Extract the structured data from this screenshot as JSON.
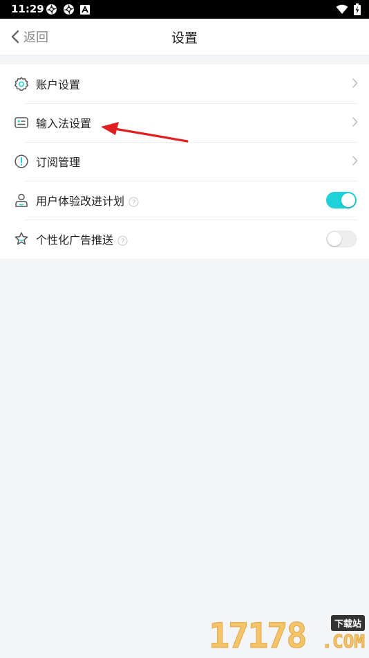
{
  "status_bar": {
    "time": "11:29",
    "icons": [
      "aperture-icon",
      "aperture-icon",
      "a-box-icon",
      "wifi-icon",
      "battery-charging-icon"
    ]
  },
  "header": {
    "back_label": "返回",
    "title": "设置"
  },
  "menu": {
    "items": [
      {
        "label": "账户设置",
        "icon": "gear-icon",
        "control": "chevron"
      },
      {
        "label": "输入法设置",
        "icon": "keyboard-icon",
        "control": "chevron"
      },
      {
        "label": "订阅管理",
        "icon": "exclamation-circle-icon",
        "control": "chevron"
      },
      {
        "label": "用户体验改进计划",
        "icon": "user-icon",
        "control": "toggle",
        "help": "?",
        "enabled": true
      },
      {
        "label": "个性化广告推送",
        "icon": "star-icon",
        "control": "toggle",
        "help": "?",
        "enabled": false
      }
    ]
  },
  "annotation": {
    "type": "red-arrow",
    "points_to": "输入法设置"
  },
  "watermark": {
    "digits": "17178",
    "badge": "下载站",
    "suffix": ".COM"
  },
  "colors": {
    "accent": "#1fd2da",
    "arrow": "#e02020",
    "background": "#f4f5f7"
  }
}
